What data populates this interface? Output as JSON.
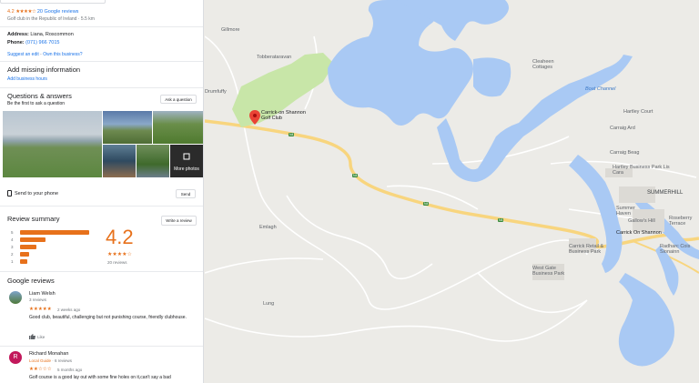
{
  "panel": {
    "rating": "4.2",
    "rating_stars": "★★★★☆",
    "reviews_link": "20 Google reviews",
    "subtitle": "Golf club in the Republic of Ireland · 5.5 km",
    "address_label": "Address:",
    "address_value": "Liana, Roscommon",
    "phone_label": "Phone:",
    "phone_value": "(071) 966 7015",
    "suggest_edit": "Suggest an edit",
    "own_business": "Own this business?",
    "add_missing_title": "Add missing information",
    "add_hours": "Add business hours",
    "qa_title": "Questions & answers",
    "qa_sub": "Be the first to ask a question",
    "ask_button": "Ask a question",
    "more_photos": "More photos",
    "send_phone": "Send to your phone",
    "send_button": "Send",
    "review_summary_title": "Review summary",
    "write_review_button": "Write a review",
    "summary_rating": "4.2",
    "summary_stars": "★★★★☆",
    "summary_count": "20 reviews",
    "rating_breakdown": [
      {
        "label": "5",
        "fraction": 0.95
      },
      {
        "label": "4",
        "fraction": 0.35
      },
      {
        "label": "3",
        "fraction": 0.22
      },
      {
        "label": "2",
        "fraction": 0.12
      },
      {
        "label": "1",
        "fraction": 0.1
      }
    ],
    "google_reviews_title": "Google reviews",
    "reviews": [
      {
        "name": "Liam Welsh",
        "meta": "3 reviews",
        "stars": "★★★★★",
        "when": "2 weeks ago",
        "text": "Good club, beautiful, challenging but not punishing course, friendly clubhouse.",
        "like": "Like"
      },
      {
        "name": "Richard Monahan",
        "badge": "Local Guide",
        "meta": "6 reviews",
        "stars": "★★☆☆☆",
        "when": "5 months ago",
        "text": "Golf course is a good lay out with some fine holes on it,can't say a bad"
      }
    ],
    "accent": "#e7711b",
    "link_color": "#1a73e8"
  },
  "map": {
    "place_pin": "Carrick-on Shannon Golf Club",
    "labels": [
      {
        "id": "gillmore",
        "text": "Gillmore",
        "kind": "plain"
      },
      {
        "id": "tobberataravan",
        "text": "Tobberataravan",
        "kind": "plain"
      },
      {
        "id": "drumfuffy",
        "text": "Drumfuffy",
        "kind": "plain"
      },
      {
        "id": "cleaheen",
        "text": "Cleaheen Cottages",
        "kind": "plain"
      },
      {
        "id": "boat-channel",
        "text": "Boat Channel",
        "kind": "water"
      },
      {
        "id": "hartley-court",
        "text": "Hartley Court",
        "kind": "plain"
      },
      {
        "id": "carraig-ard",
        "text": "Carraig Ard",
        "kind": "plain"
      },
      {
        "id": "carraig-beag",
        "text": "Carraig Beag",
        "kind": "plain"
      },
      {
        "id": "hartley-bp",
        "text": "Hartley Business Park Lis Cara",
        "kind": "plain"
      },
      {
        "id": "summerhill",
        "text": "SUMMERHILL",
        "kind": "town"
      },
      {
        "id": "summer-haven",
        "text": "Summer Haven",
        "kind": "plain"
      },
      {
        "id": "gallows-hill",
        "text": "Gallow's Hill",
        "kind": "plain"
      },
      {
        "id": "roseberry",
        "text": "Roseberry Terrace",
        "kind": "plain"
      },
      {
        "id": "carrick",
        "text": "Carrick On Shannon",
        "kind": "dark"
      },
      {
        "id": "carrick-retail",
        "text": "Carrick Retail & Business Park",
        "kind": "plain"
      },
      {
        "id": "radharc",
        "text": "Radharc Cois Sionainn",
        "kind": "plain"
      },
      {
        "id": "emlagh",
        "text": "Emlagh",
        "kind": "plain"
      },
      {
        "id": "west-gate",
        "text": "West Gate Business Park",
        "kind": "plain"
      },
      {
        "id": "lung",
        "text": "Lung",
        "kind": "plain"
      }
    ],
    "road_code": "N4"
  }
}
